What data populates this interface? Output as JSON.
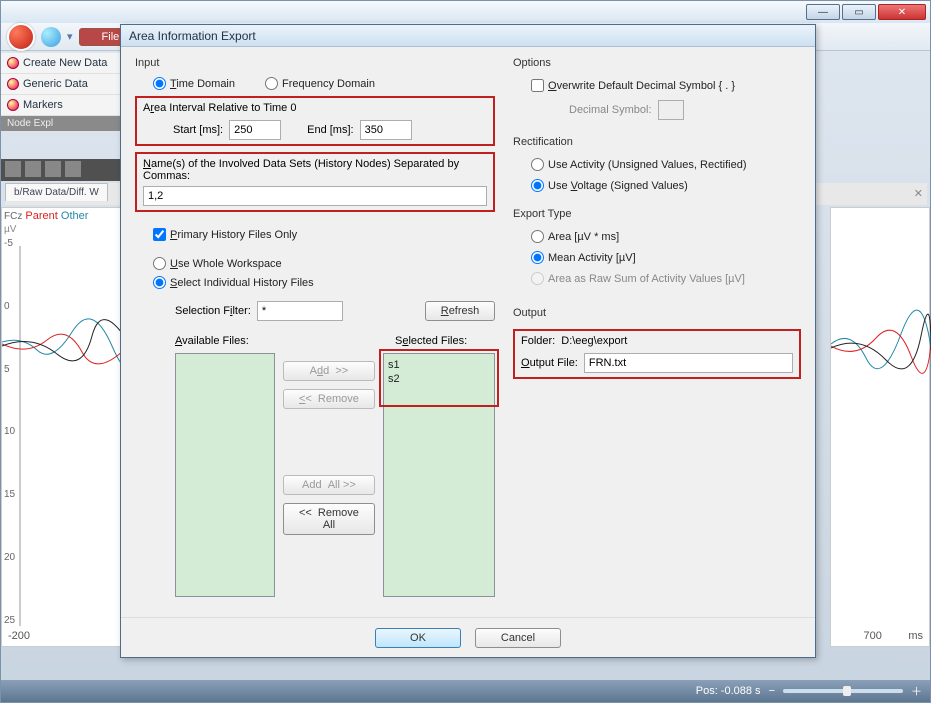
{
  "main": {
    "file_menu": "File",
    "sidebar": [
      "Create New Data",
      "Generic Data",
      "Markers"
    ],
    "node_strip": "Node Expl",
    "tab": "b/Raw Data/Diff. W",
    "channel": "FCz",
    "parent": "Parent",
    "other": "Other",
    "uv": "µV",
    "y_ticks": [
      "-5",
      "0",
      "5",
      "10",
      "15",
      "20",
      "25"
    ],
    "x_left": "-200",
    "x_right": "700",
    "x_unit": "ms",
    "pos": "Pos:  -0.088 s"
  },
  "dialog": {
    "title": "Area Information Export",
    "input": {
      "label": "Input",
      "time_domain": "Time Domain",
      "freq_domain": "Frequency Domain",
      "interval_legend": "Area Interval Relative to Time 0",
      "start_label": "Start [ms]:",
      "start_value": "250",
      "end_label": "End [ms]:",
      "end_value": "350",
      "names_label": "Name(s) of the Involved Data Sets (History Nodes) Separated by Commas:",
      "names_value": "1,2",
      "primary_only": "Primary History Files Only",
      "use_whole": "Use Whole Workspace",
      "select_individual": "Select Individual History Files",
      "filter_label": "Selection Filter:",
      "filter_value": "*",
      "refresh": "Refresh",
      "available": "Available Files:",
      "selected": "Selected Files:",
      "selected_items": [
        "s1",
        "s2"
      ],
      "add": "Add  >>",
      "remove": "<<  Remove",
      "add_all": "Add  All >>",
      "remove_all": "<<  Remove All"
    },
    "options": {
      "label": "Options",
      "overwrite": "Overwrite Default Decimal Symbol { . }",
      "decimal_label": "Decimal Symbol:",
      "rectification": "Rectification",
      "use_activity": "Use Activity (Unsigned Values, Rectified)",
      "use_voltage": "Use Voltage (Signed Values)",
      "export_type": "Export Type",
      "area": "Area [µV  *  ms]",
      "mean": "Mean Activity [µV]",
      "raw_sum": "Area as Raw Sum of Activity Values [µV]"
    },
    "output": {
      "label": "Output",
      "folder_label": "Folder:",
      "folder_value": "D:\\eeg\\export",
      "file_label": "Output File:",
      "file_value": "FRN.txt"
    },
    "ok": "OK",
    "cancel": "Cancel"
  }
}
